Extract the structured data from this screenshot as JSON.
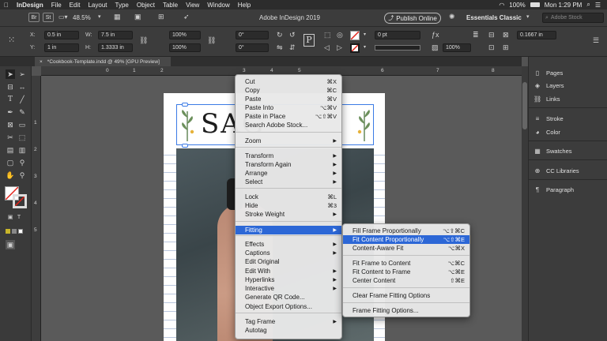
{
  "menubar": {
    "apple": "",
    "app_name": "InDesign",
    "items": [
      "File",
      "Edit",
      "Layout",
      "Type",
      "Object",
      "Table",
      "View",
      "Window",
      "Help"
    ],
    "battery": "100%",
    "clock": "Mon 1:29 PM"
  },
  "appbar": {
    "br": "Br",
    "st": "St",
    "zoom": "48.5%",
    "title": "Adobe InDesign 2019",
    "publish_online": "Publish Online",
    "workspace": "Essentials Classic",
    "search_placeholder": "Adobe Stock"
  },
  "control": {
    "x_label": "X:",
    "x_value": "0.5 in",
    "y_label": "Y:",
    "y_value": "1 in",
    "w_label": "W:",
    "w_value": "7.5 in",
    "h_label": "H:",
    "h_value": "1.3333 in",
    "scale_x": "100%",
    "scale_y": "100%",
    "rotate": "0°",
    "shear": "0°",
    "stroke_weight": "0 pt",
    "opacity": "100%",
    "offset": "0.1667 in"
  },
  "tab": {
    "close": "×",
    "label": "*Cookbook-Template.indd @ 49% [GPU Preview]"
  },
  "ruler": {
    "h_ticks": [
      "0",
      "1",
      "2",
      "3",
      "4",
      "5",
      "6",
      "7",
      "8"
    ],
    "v_ticks": [
      "1",
      "2",
      "3",
      "4",
      "5"
    ]
  },
  "page": {
    "heading_fragment": "SAG"
  },
  "panels": {
    "group1": [
      "Pages",
      "Layers",
      "Links"
    ],
    "group2": [
      "Stroke",
      "Color"
    ],
    "group3": [
      "Swatches"
    ],
    "group4": [
      "CC Libraries"
    ],
    "group5": [
      "Paragraph"
    ]
  },
  "context_menu": [
    {
      "label": "Cut",
      "key": "⌘X"
    },
    {
      "label": "Copy",
      "key": "⌘C"
    },
    {
      "label": "Paste",
      "key": "⌘V"
    },
    {
      "label": "Paste Into",
      "key": "⌥⌘V"
    },
    {
      "label": "Paste in Place",
      "key": "⌥⇧⌘V"
    },
    {
      "label": "Search Adobe Stock...",
      "key": ""
    },
    {
      "label": "Zoom",
      "key": "",
      "sub": true
    },
    {
      "label": "Transform",
      "key": "",
      "sub": true
    },
    {
      "label": "Transform Again",
      "key": "",
      "sub": true
    },
    {
      "label": "Arrange",
      "key": "",
      "sub": true
    },
    {
      "label": "Select",
      "key": "",
      "sub": true
    },
    {
      "label": "Lock",
      "key": "⌘L"
    },
    {
      "label": "Hide",
      "key": "⌘3"
    },
    {
      "label": "Stroke Weight",
      "key": "",
      "sub": true
    },
    {
      "label": "Fitting",
      "key": "",
      "sub": true,
      "highlight": true
    },
    {
      "label": "Effects",
      "key": "",
      "sub": true
    },
    {
      "label": "Captions",
      "key": "",
      "sub": true
    },
    {
      "label": "Edit Original",
      "key": ""
    },
    {
      "label": "Edit With",
      "key": "",
      "sub": true
    },
    {
      "label": "Hyperlinks",
      "key": "",
      "sub": true
    },
    {
      "label": "Interactive",
      "key": "",
      "sub": true
    },
    {
      "label": "Generate QR Code...",
      "key": ""
    },
    {
      "label": "Object Export Options...",
      "key": ""
    },
    {
      "label": "Tag Frame",
      "key": "",
      "sub": true
    },
    {
      "label": "Autotag",
      "key": ""
    }
  ],
  "fitting_submenu": [
    {
      "label": "Fill Frame Proportionally",
      "key": "⌥⇧⌘C"
    },
    {
      "label": "Fit Content Proportionally",
      "key": "⌥⇧⌘E",
      "highlight": true
    },
    {
      "label": "Content-Aware Fit",
      "key": "⌥⌘X"
    },
    {
      "label": "Fit Frame to Content",
      "key": "⌥⌘C"
    },
    {
      "label": "Fit Content to Frame",
      "key": "⌥⌘E"
    },
    {
      "label": "Center Content",
      "key": "⇧⌘E"
    },
    {
      "label": "Clear Frame Fitting Options",
      "key": ""
    },
    {
      "label": "Frame Fitting Options...",
      "key": ""
    }
  ],
  "colors": {
    "highlight": "#2c67d6",
    "frame_selection": "#3b7be6"
  }
}
